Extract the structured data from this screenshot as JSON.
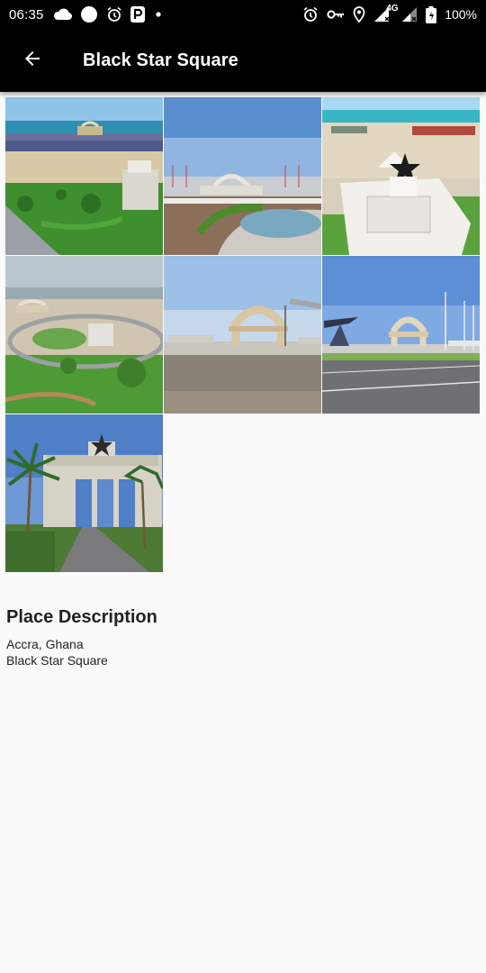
{
  "status_bar": {
    "time": "06:35",
    "network": "4G",
    "battery": "100%",
    "left_icons": [
      "cloud-icon",
      "circle-icon",
      "alarm-icon",
      "parking-icon",
      "dot-icon"
    ],
    "right_icons": [
      "alarm-icon",
      "key-icon",
      "location-icon",
      "signal-icon",
      "signal-icon",
      "battery-icon"
    ]
  },
  "app_bar": {
    "title": "Black Star Square",
    "back_icon": "arrow-back-icon"
  },
  "gallery": {
    "photos": [
      {
        "subject": "aerial view of the square with crowd and monument by the sea"
      },
      {
        "subject": "independence arch with fountain and flags"
      },
      {
        "subject": "black star gate monument from above"
      },
      {
        "subject": "aerial view of square and roundabout"
      },
      {
        "subject": "arch across open field"
      },
      {
        "subject": "arch seen from the road"
      },
      {
        "subject": "independence arch with palm trees"
      }
    ]
  },
  "description": {
    "heading": "Place Description",
    "location": "Accra, Ghana",
    "name": "Black Star Square"
  },
  "colors": {
    "bar_background": "#000000",
    "page_background": "#fafafa",
    "text": "#222222"
  }
}
